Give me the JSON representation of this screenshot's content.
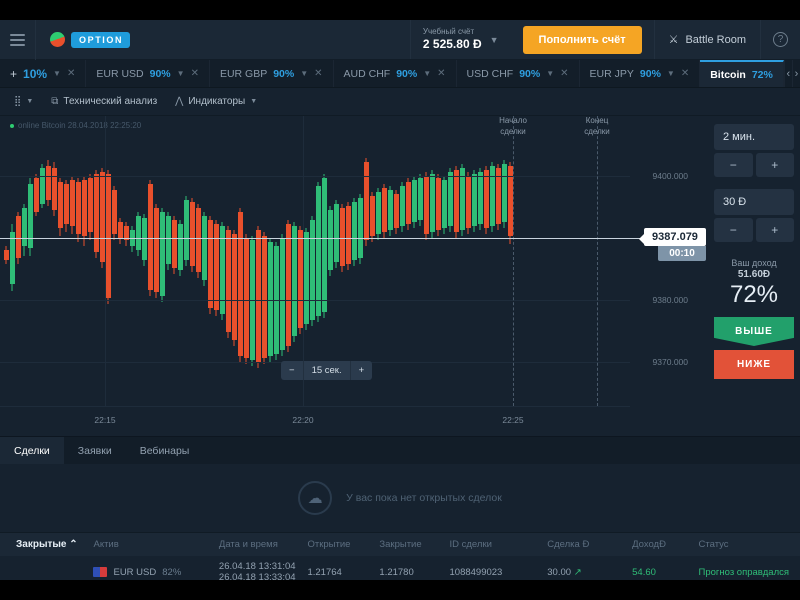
{
  "header": {
    "menu_icon": "hamburger-icon",
    "logo_badge": "OPTION",
    "account_label": "Учебный счёт",
    "account_balance": "2 525.80 Ð",
    "deposit_button": "Пополнить счёт",
    "battle_room": "Battle Room",
    "help_icon": "?"
  },
  "tabs": {
    "add_label": "+",
    "items": [
      {
        "name": "",
        "pct": "10%"
      },
      {
        "name": "EUR USD",
        "pct": "90%"
      },
      {
        "name": "EUR GBP",
        "pct": "90%"
      },
      {
        "name": "AUD CHF",
        "pct": "90%"
      },
      {
        "name": "USD CHF",
        "pct": "90%"
      },
      {
        "name": "EUR JPY",
        "pct": "90%"
      },
      {
        "name": "Bitcoin",
        "pct": "72%"
      }
    ],
    "prev": "‹",
    "next": "›"
  },
  "toolbar": {
    "chart_type": "candles-icon",
    "technical_analysis": "Технический анализ",
    "indicators": "Индикаторы"
  },
  "chart": {
    "status": "online Bitcoin 28.04.2018 22:25:20",
    "deal_start": "Начало\nсделки",
    "deal_start_l1": "Начало",
    "deal_start_l2": "сделки",
    "deal_end_l1": "Конец",
    "deal_end_l2": "сделки",
    "current_price": "9387.079",
    "countdown": "00:10",
    "timeframe": "15 сек.",
    "zoom_minus": "−",
    "zoom_plus": "+"
  },
  "chart_data": {
    "type": "line",
    "title": "Bitcoin",
    "xlabel": "",
    "ylabel": "",
    "price_ticks": [
      "9400.000",
      "9390.000",
      "9380.000",
      "9370.000"
    ],
    "ylim": [
      9365,
      9403
    ],
    "time_ticks": [
      "22:15",
      "22:20",
      "22:25"
    ],
    "current_price": 9387.079,
    "grid": true,
    "legend": "none"
  },
  "panel": {
    "duration": "2 мин.",
    "amount": "30 Ð",
    "minus": "−",
    "plus": "+",
    "income_label": "Ваш доход",
    "income_value": "51.60Ð",
    "income_pct": "72%",
    "up_button": "ВЫШЕ",
    "down_button": "НИЖЕ"
  },
  "bottom": {
    "tabs": [
      "Сделки",
      "Заявки",
      "Вебинары"
    ],
    "empty_message": "У вас пока нет открытых сделок",
    "table_headers": {
      "closed": "Закрытые",
      "asset": "Актив",
      "datetime": "Дата и время",
      "open": "Открытие",
      "close": "Закрытие",
      "deal_id": "ID сделки",
      "deal_amount": "Сделка Ð",
      "income": "ДоходÐ",
      "status": "Статус"
    },
    "rows": [
      {
        "asset": "EUR USD",
        "asset_pct": "82%",
        "date_open": "26.04.18 13:31:04",
        "date_close": "26.04.18 13:33:04",
        "open": "1.21764",
        "close": "1.21780",
        "deal_id": "1088499023",
        "deal_amount": "30.00",
        "direction_icon": "arrow-up-icon",
        "income": "54.60",
        "status": "Прогноз оправдался"
      }
    ]
  },
  "colors": {
    "accent": "#2f9fe0",
    "deposit": "#f5a524",
    "up": "#22a06b",
    "down": "#e25238",
    "bg": "#16222f"
  }
}
